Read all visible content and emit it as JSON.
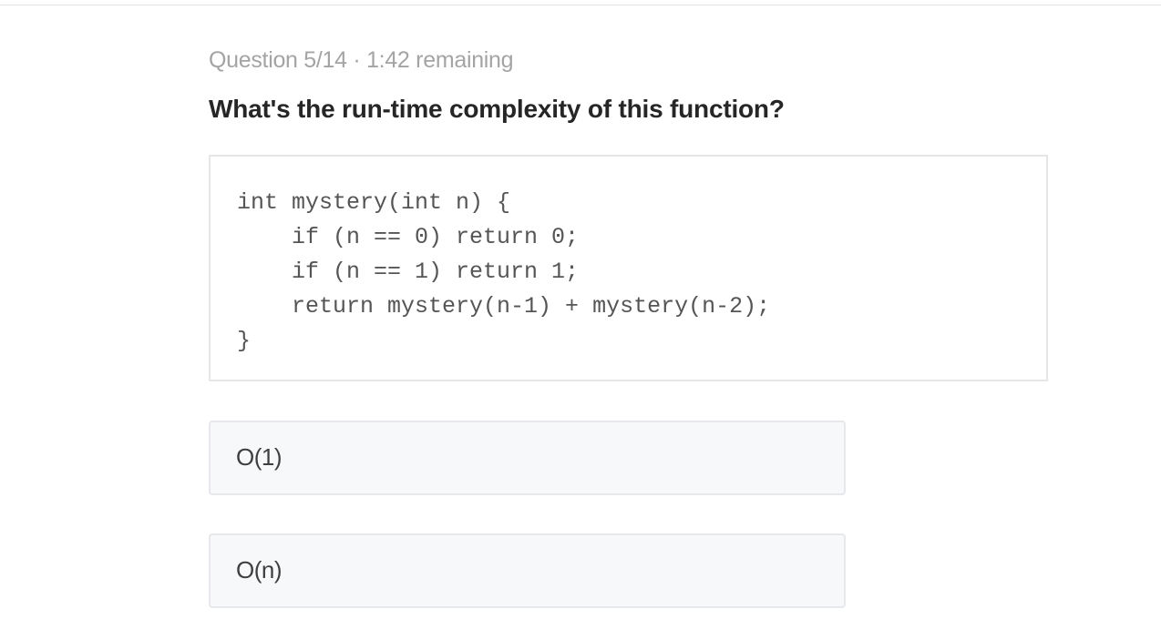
{
  "quiz": {
    "progress": "Question 5/14 · 1:42 remaining",
    "question": "What's the run-time complexity of this function?",
    "code_lines": [
      "int mystery(int n) {",
      "    if (n == 0) return 0;",
      "    if (n == 1) return 1;",
      "    return mystery(n-1) + mystery(n-2);",
      "}"
    ],
    "options": [
      {
        "label": "O(1)"
      },
      {
        "label": "O(n)"
      }
    ]
  }
}
